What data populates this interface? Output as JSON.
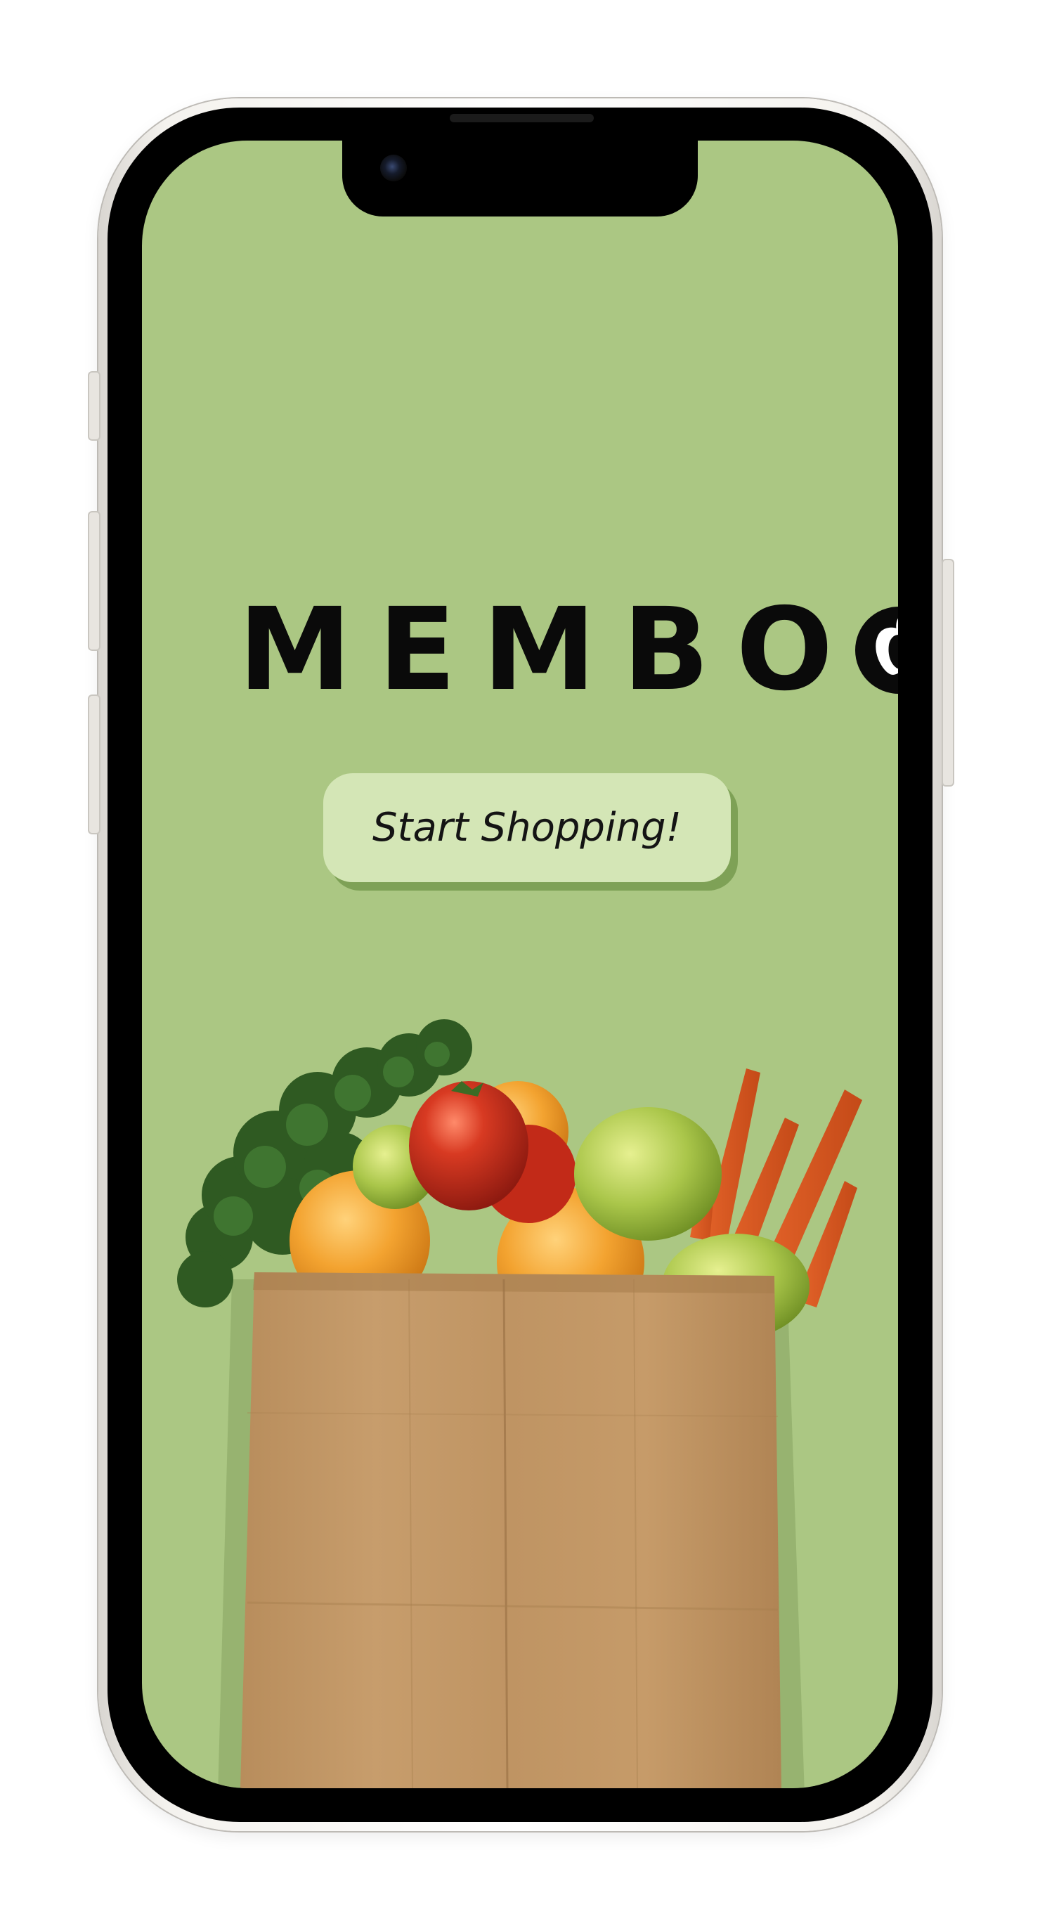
{
  "app": {
    "brand_name": "MEMBO",
    "brand_logo_icon": "apple-icon"
  },
  "main": {
    "start_button_label": "Start Shopping!"
  },
  "illustration": {
    "subject": "grocery-bag-icon"
  },
  "colors": {
    "screen_background": "#abc783",
    "button_fill": "#d4e6b6",
    "button_shadow": "#7ea156",
    "logo_text": "#0a0a0a"
  }
}
